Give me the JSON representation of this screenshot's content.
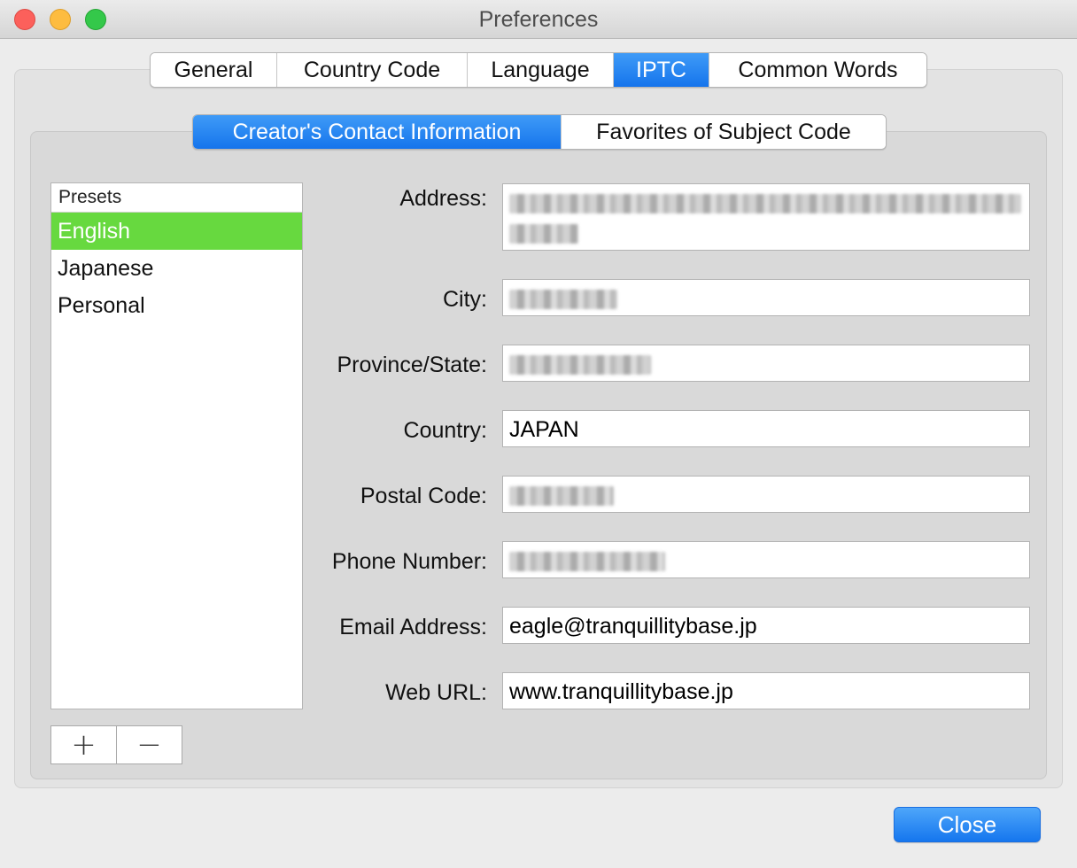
{
  "window": {
    "title": "Preferences"
  },
  "top_tabs": [
    {
      "label": "General",
      "active": false
    },
    {
      "label": "Country Code",
      "active": false
    },
    {
      "label": "Language",
      "active": false
    },
    {
      "label": "IPTC",
      "active": true
    },
    {
      "label": "Common Words",
      "active": false
    }
  ],
  "sub_tabs": [
    {
      "label": "Creator's Contact Information",
      "active": true
    },
    {
      "label": "Favorites of Subject Code",
      "active": false
    }
  ],
  "presets": {
    "header": "Presets",
    "items": [
      {
        "label": "English",
        "selected": true
      },
      {
        "label": "Japanese",
        "selected": false
      },
      {
        "label": "Personal",
        "selected": false
      }
    ],
    "add_label": "+",
    "remove_label": "−"
  },
  "form": {
    "address": {
      "label": "Address:",
      "value": "",
      "redacted": true
    },
    "city": {
      "label": "City:",
      "value": "",
      "redacted": true
    },
    "province": {
      "label": "Province/State:",
      "value": "",
      "redacted": true
    },
    "country": {
      "label": "Country:",
      "value": "JAPAN"
    },
    "postal": {
      "label": "Postal Code:",
      "value": "",
      "redacted": true
    },
    "phone": {
      "label": "Phone Number:",
      "value": "",
      "redacted": true
    },
    "email": {
      "label": "Email Address:",
      "value": "eagle@tranquillitybase.jp"
    },
    "web": {
      "label": "Web URL:",
      "value": "www.tranquillitybase.jp"
    }
  },
  "close_label": "Close",
  "colors": {
    "accent_blue": "#1574ec",
    "selection_green": "#67d93f",
    "traffic_close": "#fc605b",
    "traffic_min": "#fdbc40",
    "traffic_zoom": "#34c84a"
  }
}
